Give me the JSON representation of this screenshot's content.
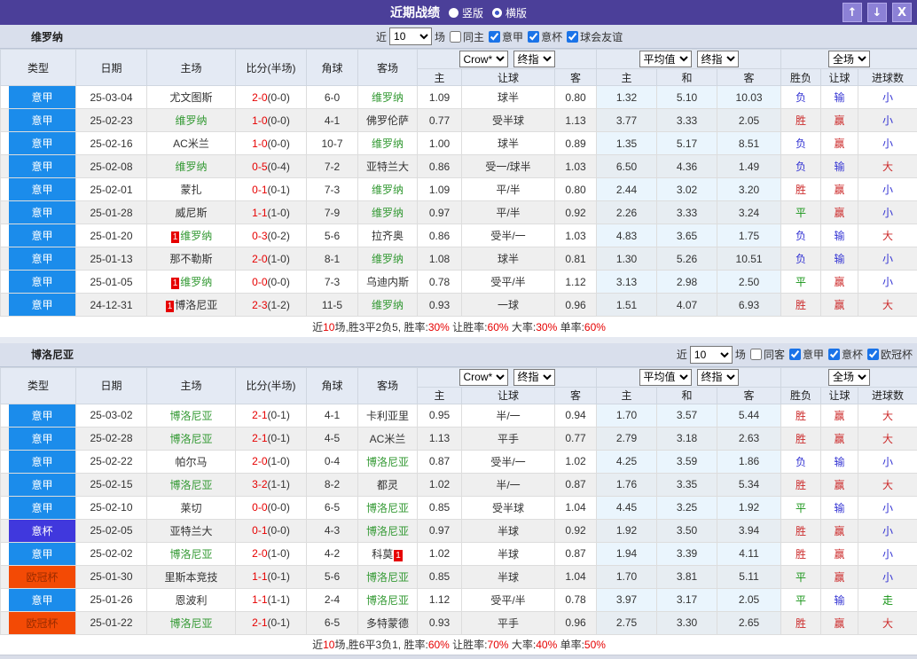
{
  "titlebar": {
    "title": "近期战绩",
    "layout_options": [
      {
        "label": "竖版",
        "selected": false
      },
      {
        "label": "横版",
        "selected": true
      }
    ],
    "buttons": {
      "up": "↑",
      "down": "↓",
      "close": "X"
    }
  },
  "colors": {
    "titlebar": "#4b3f99",
    "serie_a": "#1b8ceb",
    "coppa": "#4038dd",
    "ucl_bg": "#f34a05",
    "ucl_text": "#9b2c00",
    "team_green": "#339933",
    "score_red": "#e60000",
    "win_red": "#cc2b2b",
    "lose_blue": "#3434d3",
    "draw_green": "#169416"
  },
  "tables": [
    {
      "team": "维罗纳",
      "filter": {
        "prefix": "近",
        "count": "10",
        "suffix": "场",
        "checkboxes": [
          {
            "label": "同主",
            "checked": false
          },
          {
            "label": "意甲",
            "checked": true
          },
          {
            "label": "意杯",
            "checked": true
          },
          {
            "label": "球会友谊",
            "checked": true
          }
        ]
      },
      "selects": {
        "book": "Crow*",
        "final": "终指",
        "avg": "平均值",
        "final2": "终指",
        "scope": "全场"
      },
      "columns": [
        "类型",
        "日期",
        "主场",
        "比分(半场)",
        "角球",
        "客场",
        "主",
        "让球",
        "客",
        "主",
        "和",
        "客",
        "胜负",
        "让球",
        "进球数"
      ],
      "rows": [
        {
          "lg": "意甲",
          "lgc": "a",
          "date": "25-03-04",
          "home": "尤文图斯",
          "hh": 0,
          "hb": "",
          "score": "2-0",
          "half": "(0-0)",
          "corner": "6-0",
          "away": "维罗纳",
          "ah": 1,
          "ab": "",
          "crow": [
            "1.09",
            "球半",
            "0.80"
          ],
          "avg": [
            "1.32",
            "5.10",
            "10.03"
          ],
          "fin": [
            "负",
            "输",
            "小"
          ],
          "finc": [
            "l",
            "l",
            "l"
          ]
        },
        {
          "lg": "意甲",
          "lgc": "a",
          "date": "25-02-23",
          "home": "维罗纳",
          "hh": 1,
          "hb": "",
          "score": "1-0",
          "half": "(0-0)",
          "corner": "4-1",
          "away": "佛罗伦萨",
          "ah": 0,
          "ab": "",
          "crow": [
            "0.77",
            "受半球",
            "1.13"
          ],
          "avg": [
            "3.77",
            "3.33",
            "2.05"
          ],
          "fin": [
            "胜",
            "赢",
            "小"
          ],
          "finc": [
            "w",
            "w",
            "l"
          ]
        },
        {
          "lg": "意甲",
          "lgc": "a",
          "date": "25-02-16",
          "home": "AC米兰",
          "hh": 0,
          "hb": "",
          "score": "1-0",
          "half": "(0-0)",
          "corner": "10-7",
          "away": "维罗纳",
          "ah": 1,
          "ab": "",
          "crow": [
            "1.00",
            "球半",
            "0.89"
          ],
          "avg": [
            "1.35",
            "5.17",
            "8.51"
          ],
          "fin": [
            "负",
            "赢",
            "小"
          ],
          "finc": [
            "l",
            "w",
            "l"
          ]
        },
        {
          "lg": "意甲",
          "lgc": "a",
          "date": "25-02-08",
          "home": "维罗纳",
          "hh": 1,
          "hb": "",
          "score": "0-5",
          "half": "(0-4)",
          "corner": "7-2",
          "away": "亚特兰大",
          "ah": 0,
          "ab": "",
          "crow": [
            "0.86",
            "受一/球半",
            "1.03"
          ],
          "avg": [
            "6.50",
            "4.36",
            "1.49"
          ],
          "fin": [
            "负",
            "输",
            "大"
          ],
          "finc": [
            "l",
            "l",
            "w"
          ]
        },
        {
          "lg": "意甲",
          "lgc": "a",
          "date": "25-02-01",
          "home": "蒙扎",
          "hh": 0,
          "hb": "",
          "score": "0-1",
          "half": "(0-1)",
          "corner": "7-3",
          "away": "维罗纳",
          "ah": 1,
          "ab": "",
          "crow": [
            "1.09",
            "平/半",
            "0.80"
          ],
          "avg": [
            "2.44",
            "3.02",
            "3.20"
          ],
          "fin": [
            "胜",
            "赢",
            "小"
          ],
          "finc": [
            "w",
            "w",
            "l"
          ]
        },
        {
          "lg": "意甲",
          "lgc": "a",
          "date": "25-01-28",
          "home": "威尼斯",
          "hh": 0,
          "hb": "",
          "score": "1-1",
          "half": "(1-0)",
          "corner": "7-9",
          "away": "维罗纳",
          "ah": 1,
          "ab": "",
          "crow": [
            "0.97",
            "平/半",
            "0.92"
          ],
          "avg": [
            "2.26",
            "3.33",
            "3.24"
          ],
          "fin": [
            "平",
            "赢",
            "小"
          ],
          "finc": [
            "d",
            "w",
            "l"
          ]
        },
        {
          "lg": "意甲",
          "lgc": "a",
          "date": "25-01-20",
          "home": "维罗纳",
          "hh": 1,
          "hb": "1",
          "score": "0-3",
          "half": "(0-2)",
          "corner": "5-6",
          "away": "拉齐奥",
          "ah": 0,
          "ab": "",
          "crow": [
            "0.86",
            "受半/一",
            "1.03"
          ],
          "avg": [
            "4.83",
            "3.65",
            "1.75"
          ],
          "fin": [
            "负",
            "输",
            "大"
          ],
          "finc": [
            "l",
            "l",
            "w"
          ]
        },
        {
          "lg": "意甲",
          "lgc": "a",
          "date": "25-01-13",
          "home": "那不勒斯",
          "hh": 0,
          "hb": "",
          "score": "2-0",
          "half": "(1-0)",
          "corner": "8-1",
          "away": "维罗纳",
          "ah": 1,
          "ab": "",
          "crow": [
            "1.08",
            "球半",
            "0.81"
          ],
          "avg": [
            "1.30",
            "5.26",
            "10.51"
          ],
          "fin": [
            "负",
            "输",
            "小"
          ],
          "finc": [
            "l",
            "l",
            "l"
          ]
        },
        {
          "lg": "意甲",
          "lgc": "a",
          "date": "25-01-05",
          "home": "维罗纳",
          "hh": 1,
          "hb": "1",
          "score": "0-0",
          "half": "(0-0)",
          "corner": "7-3",
          "away": "乌迪内斯",
          "ah": 0,
          "ab": "",
          "crow": [
            "0.78",
            "受平/半",
            "1.12"
          ],
          "avg": [
            "3.13",
            "2.98",
            "2.50"
          ],
          "fin": [
            "平",
            "赢",
            "小"
          ],
          "finc": [
            "d",
            "w",
            "l"
          ]
        },
        {
          "lg": "意甲",
          "lgc": "a",
          "date": "24-12-31",
          "home": "博洛尼亚",
          "hh": 0,
          "hb": "1",
          "score": "2-3",
          "half": "(1-2)",
          "corner": "11-5",
          "away": "维罗纳",
          "ah": 1,
          "ab": "",
          "crow": [
            "0.93",
            "一球",
            "0.96"
          ],
          "avg": [
            "1.51",
            "4.07",
            "6.93"
          ],
          "fin": [
            "胜",
            "赢",
            "大"
          ],
          "finc": [
            "w",
            "w",
            "w"
          ]
        }
      ],
      "summary": [
        {
          "text": "近",
          "red": false
        },
        {
          "text": "10",
          "red": true
        },
        {
          "text": "场,胜3平2负5, 胜率:",
          "red": false
        },
        {
          "text": "30%",
          "red": true
        },
        {
          "text": " 让胜率:",
          "red": false
        },
        {
          "text": "60%",
          "red": true
        },
        {
          "text": " 大率:",
          "red": false
        },
        {
          "text": "30%",
          "red": true
        },
        {
          "text": " 单率:",
          "red": false
        },
        {
          "text": "60%",
          "red": true
        }
      ]
    },
    {
      "team": "博洛尼亚",
      "filter": {
        "prefix": "近",
        "count": "10",
        "suffix": "场",
        "checkboxes": [
          {
            "label": "同客",
            "checked": false
          },
          {
            "label": "意甲",
            "checked": true
          },
          {
            "label": "意杯",
            "checked": true
          },
          {
            "label": "欧冠杯",
            "checked": true
          }
        ]
      },
      "selects": {
        "book": "Crow*",
        "final": "终指",
        "avg": "平均值",
        "final2": "终指",
        "scope": "全场"
      },
      "columns": [
        "类型",
        "日期",
        "主场",
        "比分(半场)",
        "角球",
        "客场",
        "主",
        "让球",
        "客",
        "主",
        "和",
        "客",
        "胜负",
        "让球",
        "进球数"
      ],
      "rows": [
        {
          "lg": "意甲",
          "lgc": "a",
          "date": "25-03-02",
          "home": "博洛尼亚",
          "hh": 1,
          "hb": "",
          "score": "2-1",
          "half": "(0-1)",
          "corner": "4-1",
          "away": "卡利亚里",
          "ah": 0,
          "ab": "",
          "crow": [
            "0.95",
            "半/一",
            "0.94"
          ],
          "avg": [
            "1.70",
            "3.57",
            "5.44"
          ],
          "fin": [
            "胜",
            "赢",
            "大"
          ],
          "finc": [
            "w",
            "w",
            "w"
          ]
        },
        {
          "lg": "意甲",
          "lgc": "a",
          "date": "25-02-28",
          "home": "博洛尼亚",
          "hh": 1,
          "hb": "",
          "score": "2-1",
          "half": "(0-1)",
          "corner": "4-5",
          "away": "AC米兰",
          "ah": 0,
          "ab": "",
          "crow": [
            "1.13",
            "平手",
            "0.77"
          ],
          "avg": [
            "2.79",
            "3.18",
            "2.63"
          ],
          "fin": [
            "胜",
            "赢",
            "大"
          ],
          "finc": [
            "w",
            "w",
            "w"
          ]
        },
        {
          "lg": "意甲",
          "lgc": "a",
          "date": "25-02-22",
          "home": "帕尔马",
          "hh": 0,
          "hb": "",
          "score": "2-0",
          "half": "(1-0)",
          "corner": "0-4",
          "away": "博洛尼亚",
          "ah": 1,
          "ab": "",
          "crow": [
            "0.87",
            "受半/一",
            "1.02"
          ],
          "avg": [
            "4.25",
            "3.59",
            "1.86"
          ],
          "fin": [
            "负",
            "输",
            "小"
          ],
          "finc": [
            "l",
            "l",
            "l"
          ]
        },
        {
          "lg": "意甲",
          "lgc": "a",
          "date": "25-02-15",
          "home": "博洛尼亚",
          "hh": 1,
          "hb": "",
          "score": "3-2",
          "half": "(1-1)",
          "corner": "8-2",
          "away": "都灵",
          "ah": 0,
          "ab": "",
          "crow": [
            "1.02",
            "半/一",
            "0.87"
          ],
          "avg": [
            "1.76",
            "3.35",
            "5.34"
          ],
          "fin": [
            "胜",
            "赢",
            "大"
          ],
          "finc": [
            "w",
            "w",
            "w"
          ]
        },
        {
          "lg": "意甲",
          "lgc": "a",
          "date": "25-02-10",
          "home": "莱切",
          "hh": 0,
          "hb": "",
          "score": "0-0",
          "half": "(0-0)",
          "corner": "6-5",
          "away": "博洛尼亚",
          "ah": 1,
          "ab": "",
          "crow": [
            "0.85",
            "受半球",
            "1.04"
          ],
          "avg": [
            "4.45",
            "3.25",
            "1.92"
          ],
          "fin": [
            "平",
            "输",
            "小"
          ],
          "finc": [
            "d",
            "l",
            "l"
          ]
        },
        {
          "lg": "意杯",
          "lgc": "c",
          "date": "25-02-05",
          "home": "亚特兰大",
          "hh": 0,
          "hb": "",
          "score": "0-1",
          "half": "(0-0)",
          "corner": "4-3",
          "away": "博洛尼亚",
          "ah": 1,
          "ab": "",
          "crow": [
            "0.97",
            "半球",
            "0.92"
          ],
          "avg": [
            "1.92",
            "3.50",
            "3.94"
          ],
          "fin": [
            "胜",
            "赢",
            "小"
          ],
          "finc": [
            "w",
            "w",
            "l"
          ]
        },
        {
          "lg": "意甲",
          "lgc": "a",
          "date": "25-02-02",
          "home": "博洛尼亚",
          "hh": 1,
          "hb": "",
          "score": "2-0",
          "half": "(1-0)",
          "corner": "4-2",
          "away": "科莫",
          "ah": 0,
          "ab": "1",
          "crow": [
            "1.02",
            "半球",
            "0.87"
          ],
          "avg": [
            "1.94",
            "3.39",
            "4.11"
          ],
          "fin": [
            "胜",
            "赢",
            "小"
          ],
          "finc": [
            "w",
            "w",
            "l"
          ]
        },
        {
          "lg": "欧冠杯",
          "lgc": "u",
          "date": "25-01-30",
          "home": "里斯本竞技",
          "hh": 0,
          "hb": "",
          "score": "1-1",
          "half": "(0-1)",
          "corner": "5-6",
          "away": "博洛尼亚",
          "ah": 1,
          "ab": "",
          "crow": [
            "0.85",
            "半球",
            "1.04"
          ],
          "avg": [
            "1.70",
            "3.81",
            "5.11"
          ],
          "fin": [
            "平",
            "赢",
            "小"
          ],
          "finc": [
            "d",
            "w",
            "l"
          ]
        },
        {
          "lg": "意甲",
          "lgc": "a",
          "date": "25-01-26",
          "home": "恩波利",
          "hh": 0,
          "hb": "",
          "score": "1-1",
          "half": "(1-1)",
          "corner": "2-4",
          "away": "博洛尼亚",
          "ah": 1,
          "ab": "",
          "crow": [
            "1.12",
            "受平/半",
            "0.78"
          ],
          "avg": [
            "3.97",
            "3.17",
            "2.05"
          ],
          "fin": [
            "平",
            "输",
            "走"
          ],
          "finc": [
            "d",
            "l",
            "d"
          ]
        },
        {
          "lg": "欧冠杯",
          "lgc": "u",
          "date": "25-01-22",
          "home": "博洛尼亚",
          "hh": 1,
          "hb": "",
          "score": "2-1",
          "half": "(0-1)",
          "corner": "6-5",
          "away": "多特蒙德",
          "ah": 0,
          "ab": "",
          "crow": [
            "0.93",
            "平手",
            "0.96"
          ],
          "avg": [
            "2.75",
            "3.30",
            "2.65"
          ],
          "fin": [
            "胜",
            "赢",
            "大"
          ],
          "finc": [
            "w",
            "w",
            "w"
          ]
        }
      ],
      "summary": [
        {
          "text": "近",
          "red": false
        },
        {
          "text": "10",
          "red": true
        },
        {
          "text": "场,胜6平3负1, 胜率:",
          "red": false
        },
        {
          "text": "60%",
          "red": true
        },
        {
          "text": " 让胜率:",
          "red": false
        },
        {
          "text": "70%",
          "red": true
        },
        {
          "text": " 大率:",
          "red": false
        },
        {
          "text": "40%",
          "red": true
        },
        {
          "text": " 单率:",
          "red": false
        },
        {
          "text": "50%",
          "red": true
        }
      ]
    }
  ]
}
